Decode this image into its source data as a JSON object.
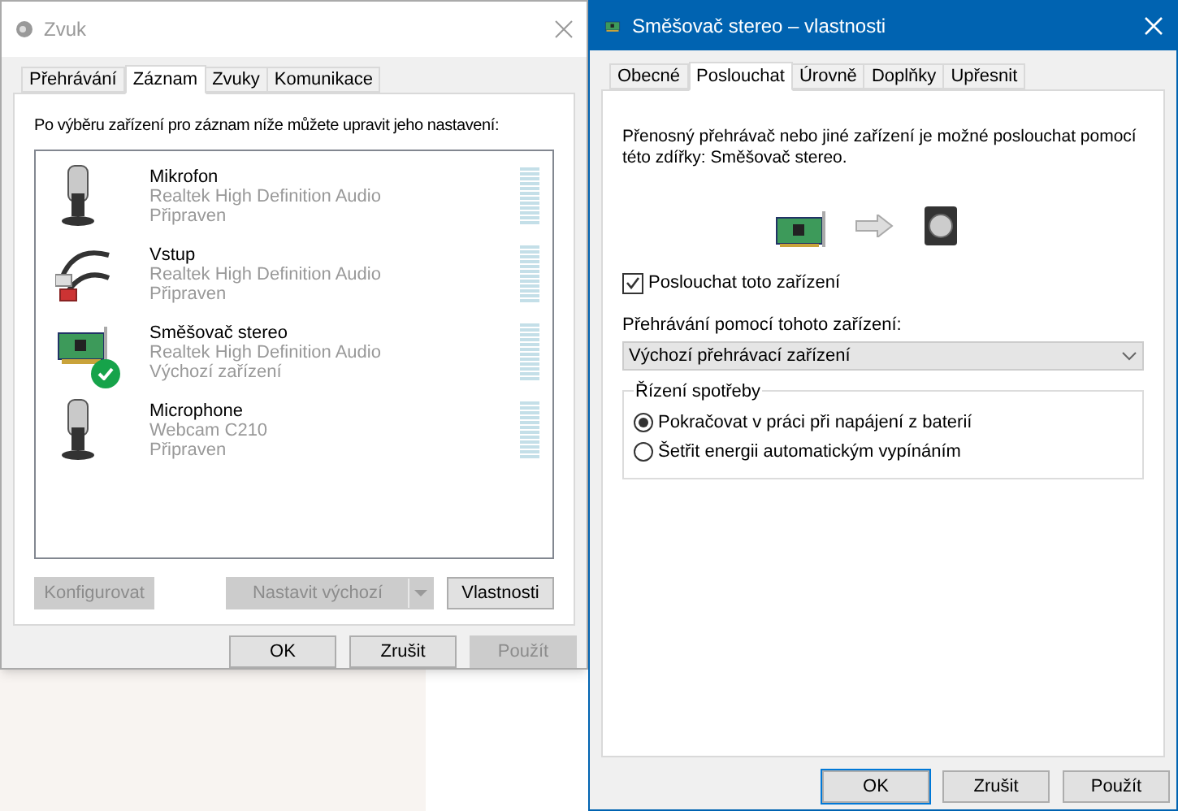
{
  "sound_window": {
    "title": "Zvuk",
    "tabs": [
      {
        "label": "Přehrávání",
        "selected": false
      },
      {
        "label": "Záznam",
        "selected": true
      },
      {
        "label": "Zvuky",
        "selected": false
      },
      {
        "label": "Komunikace",
        "selected": false
      }
    ],
    "instruction": "Po výběru zařízení pro záznam níže můžete upravit jeho nastavení:",
    "devices": [
      {
        "kind": "microphone",
        "name": "Mikrofon",
        "driver": "Realtek High Definition Audio",
        "status": "Připraven",
        "default": false
      },
      {
        "kind": "cable",
        "name": "Vstup",
        "driver": "Realtek High Definition Audio",
        "status": "Připraven",
        "default": false
      },
      {
        "kind": "card",
        "name": "Směšovač stereo",
        "driver": "Realtek High Definition Audio",
        "status": "Výchozí zařízení",
        "default": true
      },
      {
        "kind": "microphone",
        "name": "Microphone",
        "driver": "Webcam C210",
        "status": "Připraven",
        "default": false
      }
    ],
    "device_buttons": [
      {
        "kind": "plain",
        "label": "Konfigurovat",
        "disabled": true
      },
      {
        "kind": "split",
        "label": "Nastavit výchozí",
        "disabled": true
      },
      {
        "kind": "plain",
        "label": "Vlastnosti",
        "disabled": false
      }
    ],
    "buttons": [
      {
        "label": "OK",
        "disabled": false,
        "focused": false
      },
      {
        "label": "Zrušit",
        "disabled": false,
        "focused": false
      },
      {
        "label": "Použít",
        "disabled": true,
        "focused": false
      }
    ]
  },
  "properties_window": {
    "title": "Směšovač stereo – vlastnosti",
    "tabs": [
      {
        "label": "Obecné",
        "selected": false
      },
      {
        "label": "Poslouchat",
        "selected": true
      },
      {
        "label": "Úrovně",
        "selected": false
      },
      {
        "label": "Doplňky",
        "selected": false
      },
      {
        "label": "Upřesnit",
        "selected": false
      }
    ],
    "description": "Přenosný přehrávač nebo jiné zařízení je možné poslouchat pomocí této zdířky: Směšovač stereo.",
    "listen_checkbox": {
      "label": "Poslouchat toto zařízení",
      "checked": true
    },
    "playback_label": "Přehrávání pomocí tohoto zařízení:",
    "playback_select": {
      "value": "Výchozí přehrávací zařízení"
    },
    "power_group": {
      "title": "Řízení spotřeby",
      "options": [
        {
          "label": "Pokračovat v práci při napájení z baterií",
          "selected": true
        },
        {
          "label": "Šetřit energii automatickým vypínáním",
          "selected": false
        }
      ]
    },
    "buttons": [
      {
        "label": "OK",
        "disabled": false,
        "focused": true
      },
      {
        "label": "Zrušit",
        "disabled": false,
        "focused": false
      },
      {
        "label": "Použít",
        "disabled": false,
        "focused": false
      }
    ]
  }
}
